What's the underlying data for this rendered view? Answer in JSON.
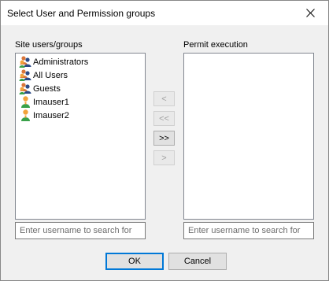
{
  "window": {
    "title": "Select User and Permission groups"
  },
  "left_panel": {
    "label": "Site users/groups",
    "items": [
      {
        "label": "Administrators",
        "icon": "group-icon"
      },
      {
        "label": "All Users",
        "icon": "group-icon"
      },
      {
        "label": "Guests",
        "icon": "group-icon"
      },
      {
        "label": "Imauser1",
        "icon": "user-icon"
      },
      {
        "label": "Imauser2",
        "icon": "user-icon"
      }
    ],
    "search_placeholder": "Enter username to search for"
  },
  "right_panel": {
    "label": "Permit execution",
    "items": [],
    "search_placeholder": "Enter username to search for"
  },
  "transfer_buttons": {
    "add_one": "<",
    "add_all": "<<",
    "remove_all": ">>",
    "remove_one": ">"
  },
  "footer": {
    "ok": "OK",
    "cancel": "Cancel"
  },
  "colors": {
    "group_user_a": "#d9763a",
    "group_user_b": "#2b4a86",
    "user_body": "#f2a33a",
    "user_shirt": "#3aa14a"
  }
}
